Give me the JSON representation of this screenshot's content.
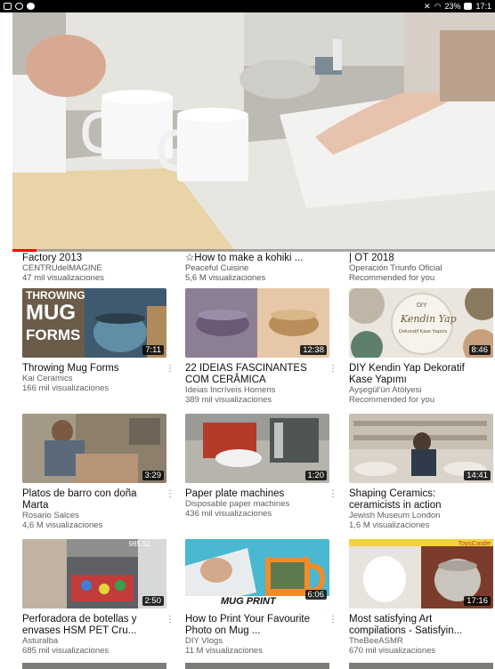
{
  "status_bar": {
    "battery": "23%",
    "time": "17:1"
  },
  "player": {
    "progress": 0.05
  },
  "top_row": [
    {
      "title": "Factory 2013",
      "channel": "CENTRUdelMAGINE",
      "stats": "47 mil visualizaciones"
    },
    {
      "title": "☆How to make a kohiki ...",
      "channel": "Peaceful Cuisine",
      "stats": "5,6 M visualizaciones"
    },
    {
      "title": "| OT 2018",
      "channel": "Operación Triunfo Oficial",
      "stats": "Recommended for you"
    }
  ],
  "videos": [
    {
      "title": "Throwing Mug Forms",
      "channel": "Kai Ceramics",
      "stats": "166 mil visualizaciones",
      "extra": "",
      "duration": "7:11",
      "thumb_text": [
        "THROWING",
        "MUG",
        "FORMS"
      ]
    },
    {
      "title": "22 IDEIAS FASCINANTES COM CERÂMICA",
      "channel": "Ideias Incríveis Homens",
      "stats": "389 mil visualizaciones",
      "extra": "",
      "duration": "12:38"
    },
    {
      "title": "DIY Kendin Yap Dekoratif Kase Yapımı",
      "channel": "Ayşegül'ün Atölyesi",
      "stats": "Recommended for you",
      "extra": "",
      "duration": "8:46",
      "thumb_text": [
        "DIY",
        "Kendin Yap",
        "Dekoratif Kase Yapımı"
      ]
    },
    {
      "title": "Platos de barro con doña Marta",
      "channel": "Rosario Salces",
      "stats": "4,6 M visualizaciones",
      "extra": "",
      "duration": "3:29"
    },
    {
      "title": "Paper plate machines",
      "channel": "Disposable paper machines",
      "stats": "436 mil visualizaciones",
      "extra": "",
      "duration": "1:20"
    },
    {
      "title": "Shaping Ceramics: ceramicists in action",
      "channel": "Jewish Museum London",
      "stats": "1,6 M visualizaciones",
      "extra": "",
      "duration": "14:41"
    },
    {
      "title": "Perforadora de botellas y envases HSM PET Cru...",
      "channel": "Asturalba",
      "stats": "685 mil visualizaciones",
      "extra": "",
      "duration": "2:50",
      "thumb_text": [
        "985 51"
      ]
    },
    {
      "title": "How to Print Your Favourite Photo on Mug ...",
      "channel": "DIY Vlogs",
      "stats": "11 M visualizaciones",
      "extra": "",
      "duration": "6:06",
      "thumb_text": [
        "MUG PRINT"
      ]
    },
    {
      "title": "Most satisfying Art compilations - Satisfyin...",
      "channel": "TheBeeASMR",
      "stats": "670 mil visualizaciones",
      "extra": "",
      "duration": "17:16",
      "thumb_text": [
        "ToysCastle"
      ]
    }
  ],
  "icons": {
    "more": "more-vert-icon",
    "wifi": "wifi-icon",
    "battery": "battery-icon",
    "mute": "mute-icon"
  },
  "colors": {
    "progress": "#ff0000",
    "status_bar": "#000000"
  }
}
